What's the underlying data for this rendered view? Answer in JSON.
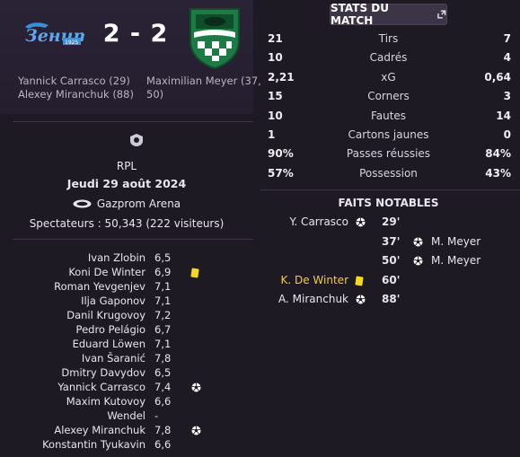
{
  "match": {
    "home_team_icon": "zenit-logo",
    "away_team_icon": "krasnodar-logo",
    "score": "2 - 2",
    "home_scorers": [
      "Yannick Carrasco (29)",
      "Alexey Miranchuk (88)"
    ],
    "away_scorers": [
      "Maximilian Meyer (37,",
      "50)"
    ],
    "competition": "RPL",
    "competition_icon": "rpl-logo",
    "date": "Jeudi 29 août 2024",
    "stadium_icon": "stadium-icon",
    "stadium": "Gazprom Arena",
    "attendance": "Spectateurs : 50,343 (222 visiteurs)"
  },
  "players": [
    {
      "name": "Ivan Zlobin",
      "rating": "6,5",
      "event": ""
    },
    {
      "name": "Koni De Winter",
      "rating": "6,9",
      "event": "yellow-card"
    },
    {
      "name": "Roman Yevgenjev",
      "rating": "7,1",
      "event": ""
    },
    {
      "name": "Ilja Gaponov",
      "rating": "7,1",
      "event": ""
    },
    {
      "name": "Danil Krugovoy",
      "rating": "7,2",
      "event": ""
    },
    {
      "name": "Pedro Pelágio",
      "rating": "6,7",
      "event": ""
    },
    {
      "name": "Eduard Löwen",
      "rating": "7,1",
      "event": ""
    },
    {
      "name": "Ivan Šaranić",
      "rating": "7,8",
      "event": ""
    },
    {
      "name": "Dmitry Davydov",
      "rating": "6,5",
      "event": ""
    },
    {
      "name": "Yannick Carrasco",
      "rating": "7,4",
      "event": "goal"
    },
    {
      "name": "Maxim Kutovoy",
      "rating": "6,6",
      "event": ""
    },
    {
      "name": "Wendel",
      "rating": "-",
      "event": ""
    },
    {
      "name": "Alexey Miranchuk",
      "rating": "7,8",
      "event": "goal"
    },
    {
      "name": "Konstantin Tyukavin",
      "rating": "6,6",
      "event": ""
    }
  ],
  "stats_button": {
    "label": "STATS DU MATCH",
    "icon": "expand-icon"
  },
  "stats": [
    {
      "label": "Tirs",
      "home": "21",
      "away": "7"
    },
    {
      "label": "Cadrés",
      "home": "10",
      "away": "4"
    },
    {
      "label": "xG",
      "home": "2,21",
      "away": "0,64"
    },
    {
      "label": "Corners",
      "home": "15",
      "away": "3"
    },
    {
      "label": "Fautes",
      "home": "10",
      "away": "14"
    },
    {
      "label": "Cartons jaunes",
      "home": "1",
      "away": "0"
    },
    {
      "label": "Passes réussies",
      "home": "90%",
      "away": "84%"
    },
    {
      "label": "Possession",
      "home": "57%",
      "away": "43%"
    }
  ],
  "notable": {
    "title": "FAITS NOTABLES",
    "events": [
      {
        "side": "home",
        "name": "Y. Carrasco",
        "minute": "29'",
        "type": "goal"
      },
      {
        "side": "away",
        "name": "M. Meyer",
        "minute": "37'",
        "type": "goal"
      },
      {
        "side": "away",
        "name": "M. Meyer",
        "minute": "50'",
        "type": "goal"
      },
      {
        "side": "home",
        "name": "K. De Winter",
        "minute": "60'",
        "type": "yellow-card"
      },
      {
        "side": "home",
        "name": "A. Miranchuk",
        "minute": "88'",
        "type": "goal"
      }
    ]
  },
  "colors": {
    "background": "#1d1a24",
    "header_bg": "#2a2336",
    "highlight": "#f2cf35",
    "yellow_card": "#f7d81e",
    "zenit_blue": "#3b8fd9",
    "krasnodar_green": "#1c7a45"
  }
}
